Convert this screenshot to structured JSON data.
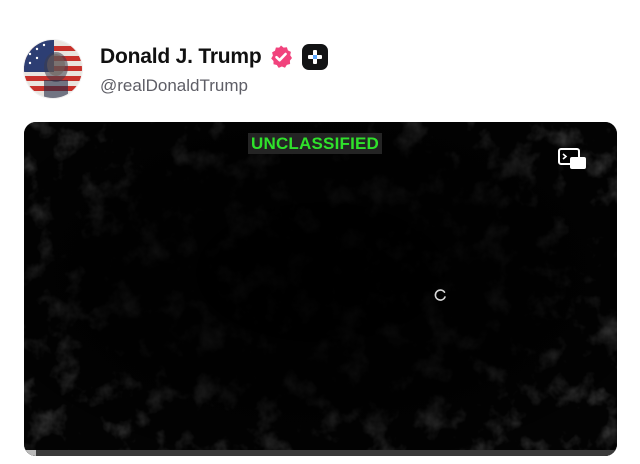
{
  "post": {
    "author": {
      "display_name": "Donald J. Trump",
      "handle": "@realDonaldTrump",
      "avatar_icon": "flag-portrait-avatar",
      "verified_icon": "verified-badge-icon",
      "verified_color": "#f1437d",
      "plus_badge_icon": "plus-badge-icon"
    },
    "video": {
      "banner_text": "UNCLASSIFIED",
      "banner_color": "#2fe12b",
      "pip_icon": "picture-in-picture-icon",
      "spinner_icon": "loading-spinner-icon",
      "progress": 0.02
    }
  }
}
